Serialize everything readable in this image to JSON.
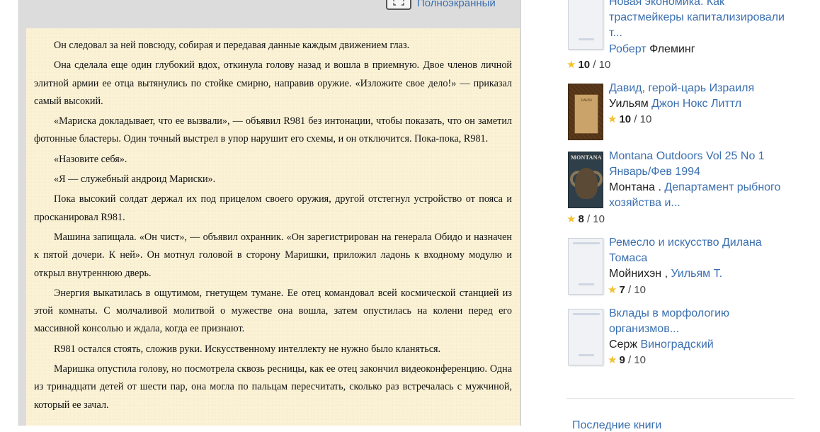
{
  "reader": {
    "fullscreen_label": "Полноэкранный",
    "paragraphs": [
      "Он следовал за ней повсюду, собирая и передавая данные каждым движением глаз.",
      "Она сделала еще один глубокий вдох, откинула голову назад и вошла в приемную. Двое членов личной элитной армии ее отца вытянулись по стойке смирно, направив оружие. «Изложите свое дело!» — приказал самый высокий.",
      "«Мариска докладывает, что ее вызвали», — объявил R981 без интонации, чтобы показать, что он заметил фотонные бластеры. Один точный выстрел в упор нарушит его схемы, и он отключится. Пока-пока, R981.",
      "«Назовите себя».",
      "«Я — служебный андроид Мариски».",
      "Пока высокий солдат держал их под прицелом своего оружия, другой отстегнул устройство от пояса и просканировал R981.",
      "Машина запищала. «Он чист», — объявил охранник. «Он зарегистрирован на генерала Обидо и назначен к пятой дочери. К ней». Он мотнул головой в сторону Маришки, приложил ладонь к входному модулю и открыл внутреннюю дверь.",
      "Энергия выкатилась в ощутимом, гнетущем тумане. Ее отец командовал всей космической станцией из этой комнаты. С молчаливой молитвой о мужестве она вошла, затем опустилась на колени перед его массивной консолью и ждала, когда ее признают.",
      "R981 остался стоять, сложив руки. Искусственному интеллекту не нужно было кланяться.",
      "Маришка опустила голову, но посмотрела сквозь ресницы, как ее отец закончил видеоконференцию. Одна из тринадцати детей от шести пар, она могла по пальцам пересчитать, сколько раз встречалась с мужчиной, который ее зачал."
    ]
  },
  "sidebar": {
    "books": [
      {
        "title_lines": [
          "Новая экономика. Как",
          "трастмейкеры капитализировали",
          "т..."
        ],
        "author_link": "Роберт",
        "author_rest": " Флеминг",
        "score": "10",
        "max": " / 10",
        "cover": "placeholder"
      },
      {
        "title_lines": [
          "Давид, герой-царь Израиля"
        ],
        "author_prefix": "Уильям ",
        "author_link": "Джон Нокс Литтл",
        "score": "10",
        "max": " / 10",
        "cover": "david"
      },
      {
        "title_lines": [
          "Montana Outdoors Vol 25 No 1",
          "Январь/Фев 1994"
        ],
        "author_prefix": "Монтана . ",
        "author_link": "Департамент рыбного",
        "author_link2": "хозяйства и...",
        "score": "8",
        "max": " / 10",
        "cover": "montana",
        "cover_text": "MONTANA"
      },
      {
        "title_lines": [
          "Ремесло и искусство Дилана",
          "Томаса"
        ],
        "author_prefix": "Мойнихэн , ",
        "author_link": "Уильям Т.",
        "score": "7",
        "max": " / 10",
        "cover": "placeholder"
      },
      {
        "title_lines": [
          "Вклады в морфологию",
          "организмов..."
        ],
        "author_prefix": "Серж ",
        "author_link": "Виноградский",
        "score": "9",
        "max": " / 10",
        "cover": "placeholder"
      }
    ],
    "next_heading": "Последние книги"
  }
}
